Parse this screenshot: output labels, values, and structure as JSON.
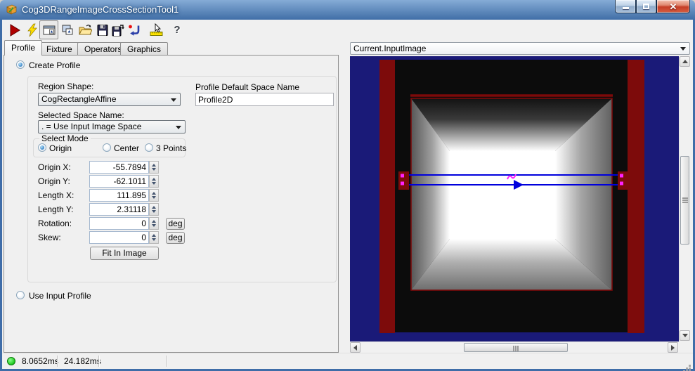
{
  "window": {
    "title": "Cog3DRangeImageCrossSectionTool1"
  },
  "window_icons": [
    "app-icon",
    "minimize-icon",
    "maximize-icon",
    "close-icon"
  ],
  "toolbar": {
    "icons": [
      "run-icon",
      "electric-run-icon",
      "tool-display-icon",
      "float-display-icon",
      "open-file-icon",
      "save-icon",
      "save-as-icon",
      "reset-icon",
      "pointer-ruler-icon",
      "help-icon"
    ]
  },
  "tabs": [
    {
      "label": "Profile",
      "active": true
    },
    {
      "label": "Fixture",
      "active": false
    },
    {
      "label": "Operators",
      "active": false
    },
    {
      "label": "Graphics",
      "active": false
    }
  ],
  "create_profile": {
    "radio_label": "Create Profile",
    "selected": true,
    "region_shape": {
      "label": "Region Shape:",
      "value": "CogRectangleAffine"
    },
    "profile_default_space": {
      "label": "Profile Default Space Name",
      "value": "Profile2D"
    },
    "selected_space": {
      "label": "Selected Space Name:",
      "value": ". = Use Input Image Space"
    },
    "select_mode": {
      "label": "Select Mode",
      "options": [
        {
          "label": "Origin",
          "selected": true
        },
        {
          "label": "Center",
          "selected": false
        },
        {
          "label": "3 Points",
          "selected": false
        }
      ]
    },
    "fields": [
      {
        "label": "Origin X:",
        "value": "-55.7894"
      },
      {
        "label": "Origin Y:",
        "value": "-62.1011"
      },
      {
        "label": "Length X:",
        "value": "111.895"
      },
      {
        "label": "Length Y:",
        "value": "2.31118"
      },
      {
        "label": "Rotation:",
        "value": "0",
        "unit": "deg"
      },
      {
        "label": "Skew:",
        "value": "0",
        "unit": "deg"
      }
    ],
    "fit_button_label": "Fit In Image"
  },
  "use_input_profile": {
    "label": "Use Input Profile",
    "selected": false
  },
  "display": {
    "source": "Current.InputImage"
  },
  "status": {
    "time1": "8.0652ms",
    "time2": "24.182ms",
    "indicator": "green"
  },
  "colors": {
    "titlebar-blue": "#3f6da8",
    "navy-bg": "#1a1a78",
    "range-red": "#7d0b0b",
    "overlay-blue": "#0000dd",
    "overlay-magenta": "#ff22ff",
    "status-green": "#1fc81f",
    "accent-select": "#2d7cc2"
  }
}
